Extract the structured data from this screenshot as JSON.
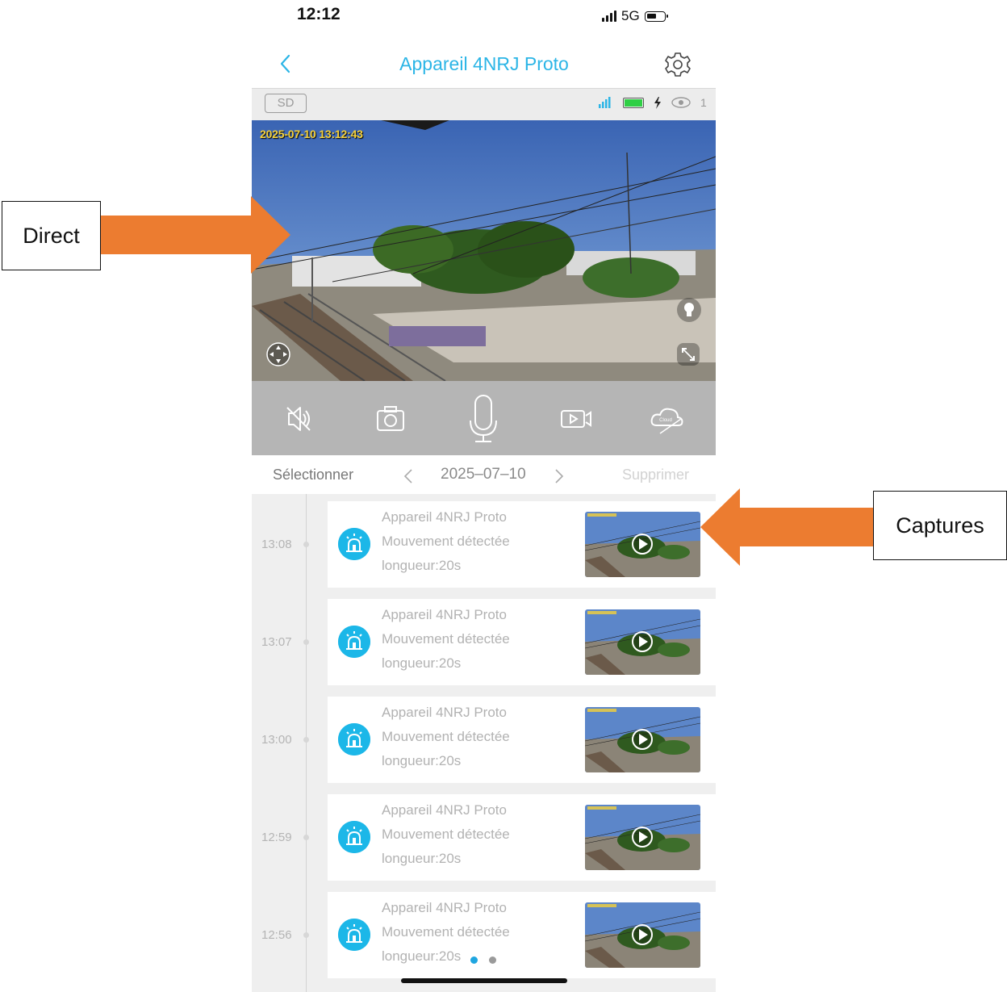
{
  "status_bar": {
    "time": "12:12",
    "network": "5G"
  },
  "nav": {
    "title": "Appareil 4NRJ Proto",
    "back_icon": "chevron-left-icon",
    "settings_icon": "gear-icon"
  },
  "camera_status": {
    "quality": "SD",
    "viewer_count": "1"
  },
  "live": {
    "timestamp": "2025-07-10 13:12:43"
  },
  "controls": [
    {
      "name": "mute-button",
      "icon": "speaker-muted-icon"
    },
    {
      "name": "snapshot-button",
      "icon": "camera-icon"
    },
    {
      "name": "talk-button",
      "icon": "microphone-icon"
    },
    {
      "name": "record-button",
      "icon": "video-record-icon"
    },
    {
      "name": "cloud-button",
      "icon": "cloud-off-icon"
    }
  ],
  "date_bar": {
    "select": "Sélectionner",
    "date": "2025–07–10",
    "delete": "Supprimer"
  },
  "events": [
    {
      "time": "13:08",
      "device": "Appareil 4NRJ Proto",
      "description": "Mouvement détectée",
      "length": "longueur:20s"
    },
    {
      "time": "13:07",
      "device": "Appareil 4NRJ Proto",
      "description": "Mouvement détectée",
      "length": "longueur:20s"
    },
    {
      "time": "13:00",
      "device": "Appareil 4NRJ Proto",
      "description": "Mouvement détectée",
      "length": "longueur:20s"
    },
    {
      "time": "12:59",
      "device": "Appareil 4NRJ Proto",
      "description": "Mouvement détectée",
      "length": "longueur:20s"
    },
    {
      "time": "12:56",
      "device": "Appareil 4NRJ Proto",
      "description": "Mouvement détectée",
      "length": "longueur:20s"
    }
  ],
  "annotations": {
    "live_label": "Direct",
    "captures_label": "Captures",
    "arrow_color": "#ec7c30"
  },
  "colors": {
    "accent": "#2bb5e6",
    "alarm": "#1cb7e8",
    "dot_active": "#1fa6e0",
    "dot_inactive": "#9a9a9a"
  }
}
